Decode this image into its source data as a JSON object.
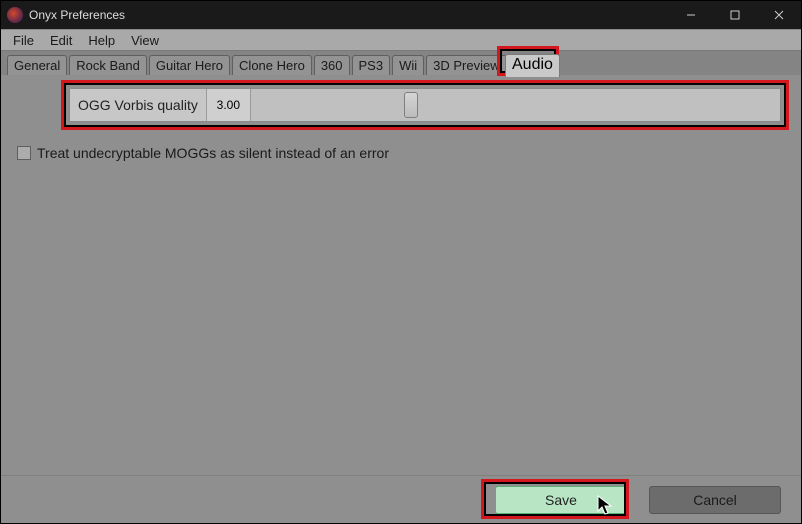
{
  "window": {
    "title": "Onyx Preferences"
  },
  "menubar": {
    "items": [
      "File",
      "Edit",
      "Help",
      "View"
    ]
  },
  "tabs": {
    "items": [
      "General",
      "Rock Band",
      "Guitar Hero",
      "Clone Hero",
      "360",
      "PS3",
      "Wii",
      "3D Preview",
      "Audio"
    ],
    "active_index": 8
  },
  "audio": {
    "slider_label": "OGG Vorbis quality",
    "slider_value": "3.00",
    "slider_position_pct": 29,
    "checkbox_label": "Treat undecryptable MOGGs as silent instead of an error",
    "checkbox_checked": false
  },
  "buttons": {
    "save": "Save",
    "cancel": "Cancel"
  },
  "highlights": {
    "tab_audio": true,
    "slider_box": true,
    "save_button": true
  }
}
